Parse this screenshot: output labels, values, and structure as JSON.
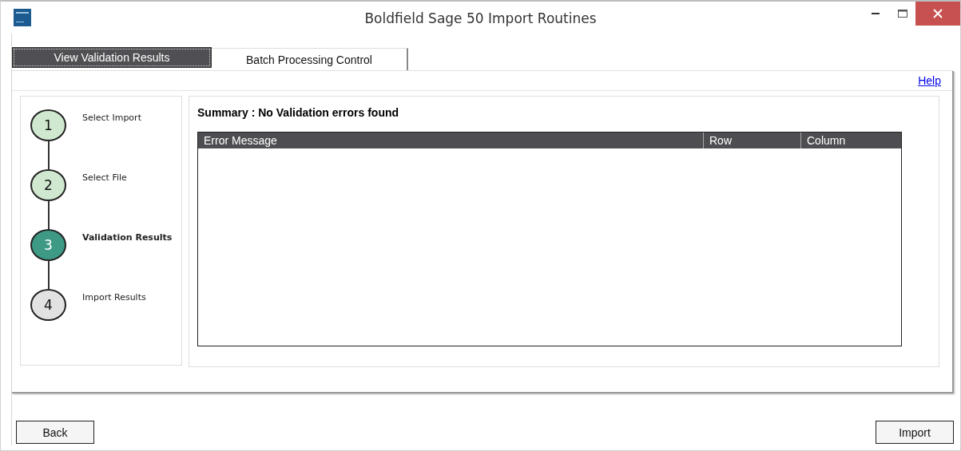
{
  "window": {
    "title": "Boldfield Sage 50 Import Routines"
  },
  "tabs": [
    {
      "label": "View Validation Results",
      "selected": true
    },
    {
      "label": "Batch Processing Control",
      "selected": false
    }
  ],
  "help_link": "Help",
  "steps": [
    {
      "number": "1",
      "label": "Select Import",
      "completed": true,
      "current": false
    },
    {
      "number": "2",
      "label": "Select File",
      "completed": true,
      "current": false
    },
    {
      "number": "3",
      "label": "Validation Results",
      "completed": false,
      "current": true
    },
    {
      "number": "4",
      "label": "Import Results",
      "completed": false,
      "current": false
    }
  ],
  "summary": "Summary : No Validation errors found",
  "table": {
    "columns": [
      "Error Message",
      "Row",
      "Column"
    ]
  },
  "buttons": {
    "back": "Back",
    "import": "Import"
  }
}
